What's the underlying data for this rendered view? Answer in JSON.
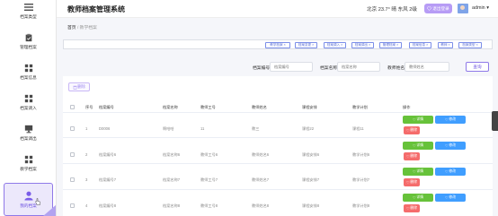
{
  "app": {
    "title": "教师档案管理系统"
  },
  "header": {
    "weather": "北京 23.7° 晴 东风 2级",
    "exit_label": "退出登录",
    "user": "admin"
  },
  "sidebar": {
    "items": [
      {
        "label": "档案类型",
        "icon": "list-icon"
      },
      {
        "label": "管理档案",
        "icon": "clipboard-icon"
      },
      {
        "label": "档案信息",
        "icon": "grid-icon"
      },
      {
        "label": "档案调入",
        "icon": "grid-icon"
      },
      {
        "label": "档案调出",
        "icon": "computer-icon"
      },
      {
        "label": "教学档案",
        "icon": "grid-icon"
      },
      {
        "label": "我的档案",
        "icon": "user-icon"
      }
    ]
  },
  "breadcrumb": {
    "home": "首页",
    "sep": "/",
    "current": "教学档案"
  },
  "filters": [
    "教学档案 ×",
    "档案变更 ×",
    "档案调入 ×",
    "档案调出 ×",
    "管理档案 ×",
    "档案信息 ×",
    "教师 ×",
    "档案类型 ×"
  ],
  "search": {
    "field1_label": "档案编号",
    "field1_placeholder": "档案编号",
    "field2_label": "档案名称",
    "field2_placeholder": "档案名称",
    "field3_label": "教师姓名",
    "field3_placeholder": "教师姓名",
    "button": "查询"
  },
  "toolbar": {
    "delete_label": "删除"
  },
  "table": {
    "headers": [
      "序号",
      "档案编号",
      "档案名称",
      "教师工号",
      "教师姓名",
      "课程安排",
      "教学计划",
      "操作"
    ],
    "rows": [
      [
        "1",
        "D0006",
        "啊哈哈",
        "11",
        "教三",
        "课程22",
        "课程11"
      ],
      [
        "2",
        "档案编号6",
        "档案名称6",
        "教师工号6",
        "教师姓名6",
        "课程安排6",
        "教学计划6"
      ],
      [
        "3",
        "档案编号7",
        "档案名称7",
        "教师工号7",
        "教师姓名7",
        "课程安排7",
        "教学计划7"
      ],
      [
        "4",
        "档案编号8",
        "档案名称8",
        "教师工号8",
        "教师姓名8",
        "课程安排8",
        "教学计划8"
      ]
    ],
    "actions": {
      "detail": "详情",
      "edit": "修改",
      "delete": "删除"
    }
  },
  "colors": {
    "accent": "#8f79e8",
    "detail": "#67c23a",
    "edit": "#409eff",
    "delete": "#f56c6c"
  }
}
